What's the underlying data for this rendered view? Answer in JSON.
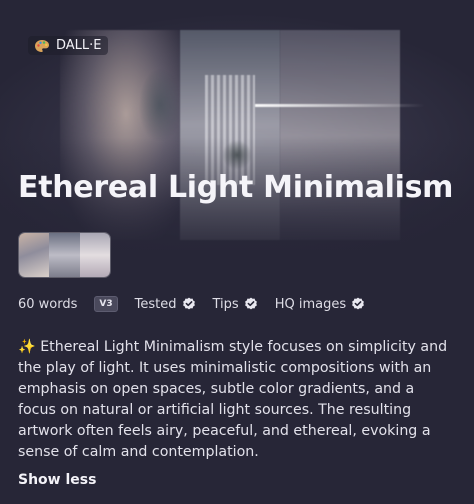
{
  "badge": {
    "icon": "palette-icon",
    "label": "DALL·E"
  },
  "title": "Ethereal Light Minimalism",
  "meta": {
    "words": "60 words",
    "version": "V3",
    "tested": "Tested",
    "tips": "Tips",
    "hq": "HQ images",
    "check_icon": "verified-check-icon"
  },
  "description": {
    "sparkle": "✨",
    "text": "Ethereal Light Minimalism style focuses on simplicity and the play of light. It uses minimalistic compositions with an emphasis on open spaces, subtle color gradients, and a focus on natural or artificial light sources. The resulting artwork often feels airy, peaceful, and ethereal, evoking a sense of calm and contemplation."
  },
  "toggle_label": "Show less",
  "colors": {
    "background": "#272637",
    "text": "#ecebf2",
    "badge_bg": "#4a495c",
    "sparkle": "#f5c542"
  }
}
